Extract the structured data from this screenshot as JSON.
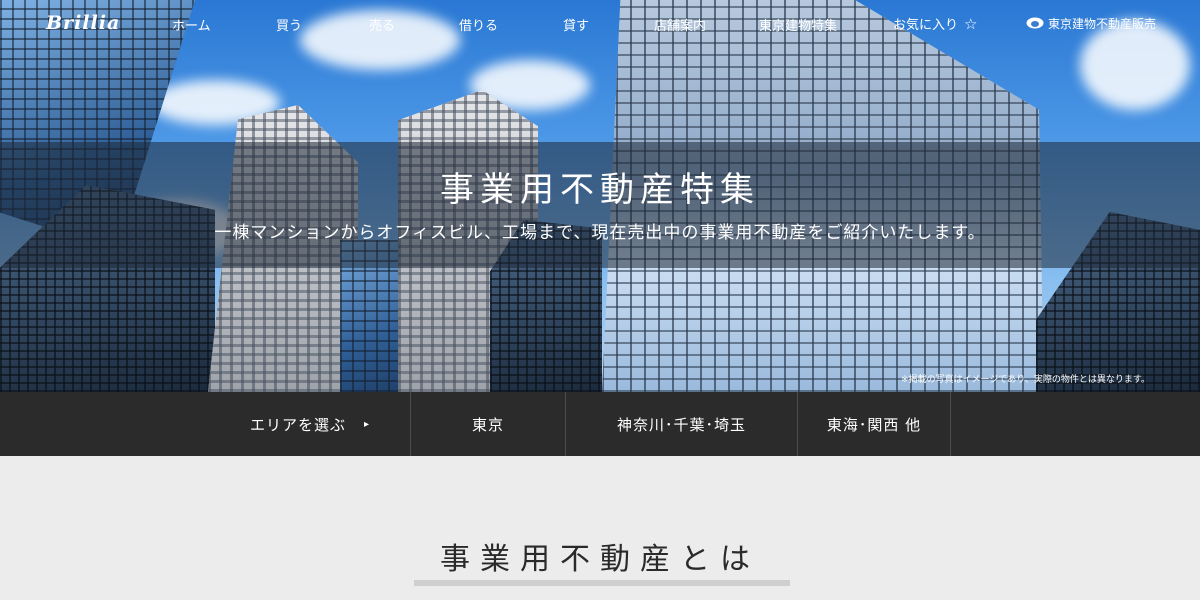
{
  "header": {
    "logo": "Brillia",
    "nav": [
      "ホーム",
      "買う",
      "売る",
      "借りる",
      "貸す",
      "店舗案内",
      "東京建物特集"
    ],
    "favorites": "お気に入り",
    "corporate": "東京建物不動産販売"
  },
  "hero": {
    "title": "事業用不動産特集",
    "subtitle": "一棟マンションからオフィスビル、工場まで、現在売出中の事業用不動産をご紹介いたします。",
    "note": "※掲載の写真はイメージであり、実際の物件とは異なります。"
  },
  "area_bar": {
    "select_label": "エリアを選ぶ",
    "areas": [
      "東京",
      "神奈川･千葉･埼玉",
      "東海･関西 他"
    ]
  },
  "section": {
    "title": "事業用不動産とは"
  },
  "colors": {
    "area_bar_bg": "#2b2b2b",
    "page_bg": "#ececec",
    "banner_overlay": "rgba(30,40,55,0.55)"
  }
}
